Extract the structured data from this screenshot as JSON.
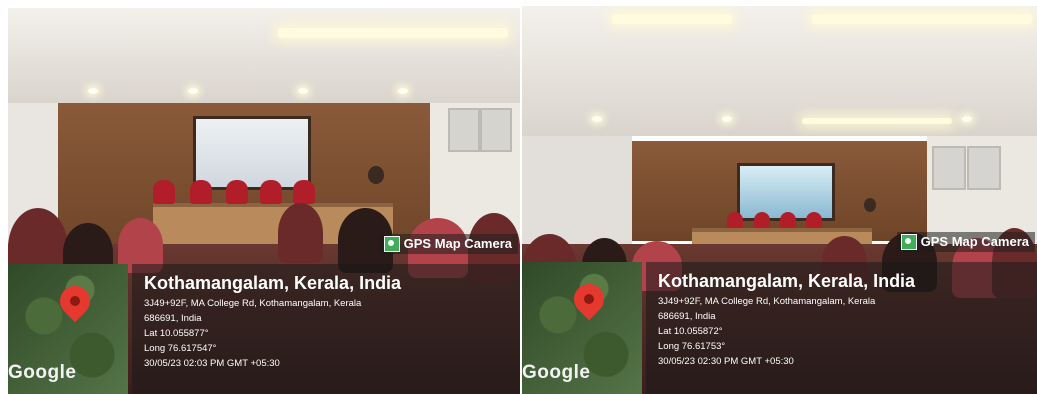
{
  "photos": [
    {
      "app_tag": "GPS Map Camera",
      "city": "Kothamangalam, Kerala, India",
      "address_line1": "3J49+92F, MA College Rd, Kothamangalam, Kerala",
      "address_line2": "686691, India",
      "lat": "Lat 10.055877°",
      "long": "Long 76.617547°",
      "datetime": "30/05/23 02:03 PM GMT +05:30",
      "map_brand": "Google"
    },
    {
      "app_tag": "GPS Map Camera",
      "city": "Kothamangalam, Kerala, India",
      "address_line1": "3J49+92F, MA College Rd, Kothamangalam, Kerala",
      "address_line2": "686691, India",
      "lat": "Lat 10.055872°",
      "long": "Long 76.61753°",
      "datetime": "30/05/23 02:30 PM GMT +05:30",
      "map_brand": "Google"
    }
  ],
  "colors": {
    "pin": "#e5382f",
    "chair": "#b21d2a",
    "gps_icon": "#3fae59"
  }
}
